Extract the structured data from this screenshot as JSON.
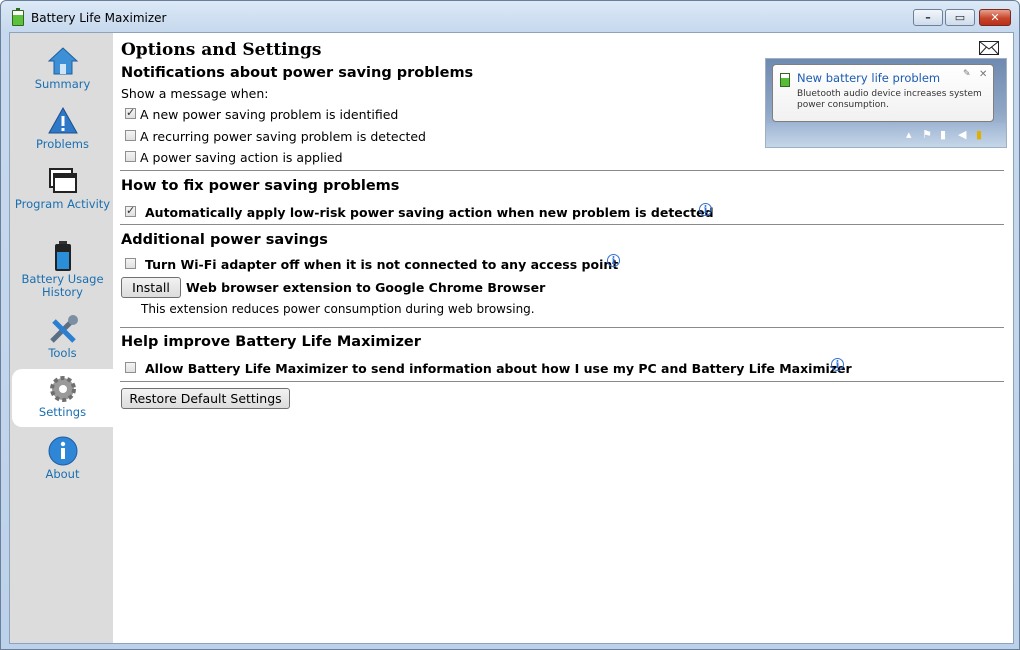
{
  "window": {
    "title": "Battery Life Maximizer",
    "accent": "#1a6fb0"
  },
  "sidebar": {
    "items": [
      {
        "label": "Summary",
        "icon": "home-icon"
      },
      {
        "label": "Problems",
        "icon": "warning-icon"
      },
      {
        "label": "Program Activity",
        "icon": "windows-icon"
      },
      {
        "label": "Battery Usage History",
        "icon": "battery-icon"
      },
      {
        "label": "Tools",
        "icon": "tools-icon"
      },
      {
        "label": "Settings",
        "icon": "gear-icon",
        "active": true
      },
      {
        "label": "About",
        "icon": "info-icon"
      }
    ]
  },
  "main": {
    "title": "Options and Settings",
    "notifications": {
      "heading": "Notifications about power saving problems",
      "intro": "Show a message when:",
      "options": [
        {
          "label": "A new power saving problem is identified",
          "checked": true
        },
        {
          "label": "A recurring power saving problem is detected",
          "checked": false
        },
        {
          "label": "A power saving action is applied",
          "checked": false
        }
      ],
      "preview": {
        "title": "New battery life problem",
        "body": "Bluetooth audio device increases system power consumption."
      }
    },
    "fix": {
      "heading": "How to fix power saving problems",
      "option": {
        "label": "Automatically apply low-risk power saving action when new problem is detected",
        "checked": true
      }
    },
    "additional": {
      "heading": "Additional power savings",
      "option": {
        "label": "Turn Wi-Fi adapter off when it is not connected to any access point",
        "checked": false
      },
      "install_button": "Install",
      "extension_label": "Web browser extension to Google Chrome Browser",
      "extension_desc": "This extension reduces power consumption during web browsing."
    },
    "improve": {
      "heading": "Help improve Battery Life Maximizer",
      "option": {
        "label": "Allow Battery Life Maximizer to send information about how I use my PC and Battery Life Maximizer",
        "checked": false
      }
    },
    "restore_button": "Restore Default Settings"
  }
}
